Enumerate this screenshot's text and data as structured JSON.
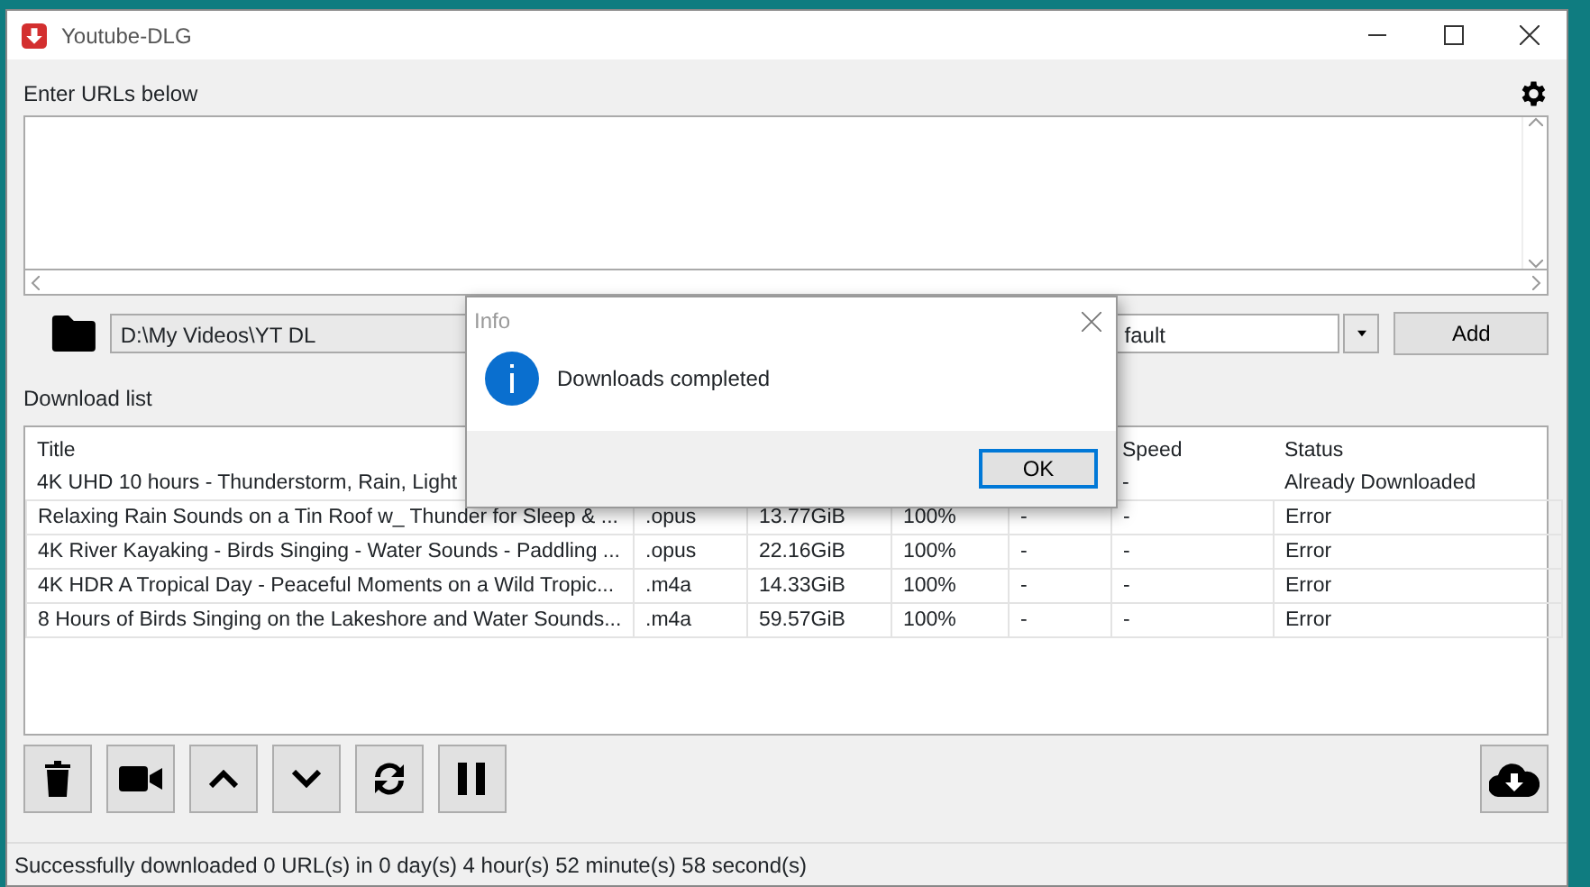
{
  "window": {
    "title": "Youtube-DLG"
  },
  "urls": {
    "label": "Enter URLs below"
  },
  "path": {
    "value": "D:\\My Videos\\YT DL"
  },
  "format": {
    "value": "fault"
  },
  "add_button": "Add",
  "download_list": {
    "label": "Download list",
    "headers": {
      "title": "Title",
      "speed": "Speed",
      "status": "Status"
    },
    "rows": [
      {
        "title": "4K UHD 10 hours - Thunderstorm, Rain, Light",
        "speed": "-",
        "status": "Already Downloaded"
      },
      {
        "title": "Relaxing Rain Sounds on a Tin Roof w_ Thunder for Sleep & ...",
        "extension": ".opus",
        "size": "13.77GiB",
        "percent": "100%",
        "eta": "-",
        "speed": "-",
        "status": "Error"
      },
      {
        "title": "4K River Kayaking - Birds Singing - Water Sounds - Paddling ...",
        "extension": ".opus",
        "size": "22.16GiB",
        "percent": "100%",
        "eta": "-",
        "speed": "-",
        "status": "Error"
      },
      {
        "title": "4K HDR A Tropical Day - Peaceful Moments on a Wild Tropic...",
        "extension": ".m4a",
        "size": "14.33GiB",
        "percent": "100%",
        "eta": "-",
        "speed": "-",
        "status": "Error"
      },
      {
        "title": "8 Hours of Birds Singing on the Lakeshore and Water Sounds...",
        "extension": ".m4a",
        "size": "59.57GiB",
        "percent": "100%",
        "eta": "-",
        "speed": "-",
        "status": "Error"
      }
    ]
  },
  "toolbar": [
    {
      "kind": "delete"
    },
    {
      "kind": "video"
    },
    {
      "kind": "up"
    },
    {
      "kind": "down"
    },
    {
      "kind": "reload"
    },
    {
      "kind": "pause"
    }
  ],
  "status_bar": "Successfully downloaded 0 URL(s) in 0 day(s) 4 hour(s) 52 minute(s) 58 second(s)",
  "dialog": {
    "title": "Info",
    "message": "Downloads completed",
    "button": "OK"
  }
}
